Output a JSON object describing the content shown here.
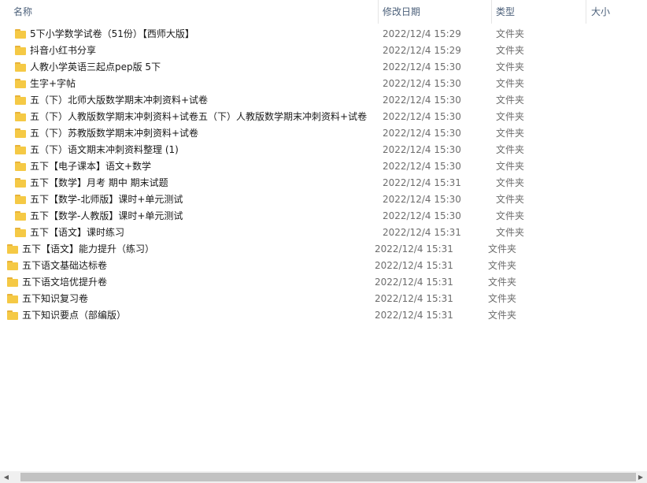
{
  "columns": {
    "name": "名称",
    "date": "修改日期",
    "type": "类型",
    "size": "大小"
  },
  "icons": {
    "folder": "folder-icon",
    "sort": "sort-up-icon",
    "scroll_left": "chevron-left-icon",
    "scroll_right": "chevron-right-icon"
  },
  "sort_glyph": "⌃",
  "scroll_left_glyph": "◀",
  "scroll_right_glyph": "▶",
  "colors": {
    "header_text": "#4c607a",
    "folder": "#f5c945",
    "folder_tab": "#e8b33a"
  },
  "rows": [
    {
      "name": "5下小学数学试卷（51份）【西师大版】",
      "date": "2022/12/4 15:29",
      "type": "文件夹"
    },
    {
      "name": "抖音小红书分享",
      "date": "2022/12/4 15:29",
      "type": "文件夹"
    },
    {
      "name": "人教小学英语三起点pep版 5下",
      "date": "2022/12/4 15:30",
      "type": "文件夹"
    },
    {
      "name": "生字+字帖",
      "date": "2022/12/4 15:30",
      "type": "文件夹"
    },
    {
      "name": "五（下）北师大版数学期末冲刺资料+试卷",
      "date": "2022/12/4 15:30",
      "type": "文件夹"
    },
    {
      "name": "五（下）人教版数学期末冲刺资料+试卷五（下）人教版数学期末冲刺资料+试卷",
      "date": "2022/12/4 15:30",
      "type": "文件夹"
    },
    {
      "name": "五（下）苏教版数学期末冲刺资料+试卷",
      "date": "2022/12/4 15:30",
      "type": "文件夹"
    },
    {
      "name": "五（下）语文期末冲刺资料整理 (1)",
      "date": "2022/12/4 15:30",
      "type": "文件夹"
    },
    {
      "name": "五下【电子课本】语文+数学",
      "date": "2022/12/4 15:30",
      "type": "文件夹"
    },
    {
      "name": "五下【数学】月考 期中 期末试题",
      "date": "2022/12/4 15:31",
      "type": "文件夹"
    },
    {
      "name": "五下【数学-北师版】课时+单元测试",
      "date": "2022/12/4 15:30",
      "type": "文件夹"
    },
    {
      "name": "五下【数学-人教版】课时+单元测试",
      "date": "2022/12/4 15:30",
      "type": "文件夹"
    },
    {
      "name": "五下【语文】课时练习",
      "date": "2022/12/4 15:31",
      "type": "文件夹"
    },
    {
      "name": "五下【语文】能力提升（练习）",
      "date": "2022/12/4 15:31",
      "type": "文件夹"
    },
    {
      "name": "五下语文基础达标卷",
      "date": "2022/12/4 15:31",
      "type": "文件夹"
    },
    {
      "name": "五下语文培优提升卷",
      "date": "2022/12/4 15:31",
      "type": "文件夹"
    },
    {
      "name": "五下知识复习卷",
      "date": "2022/12/4 15:31",
      "type": "文件夹"
    },
    {
      "name": "五下知识要点（部编版）",
      "date": "2022/12/4 15:31",
      "type": "文件夹"
    }
  ]
}
